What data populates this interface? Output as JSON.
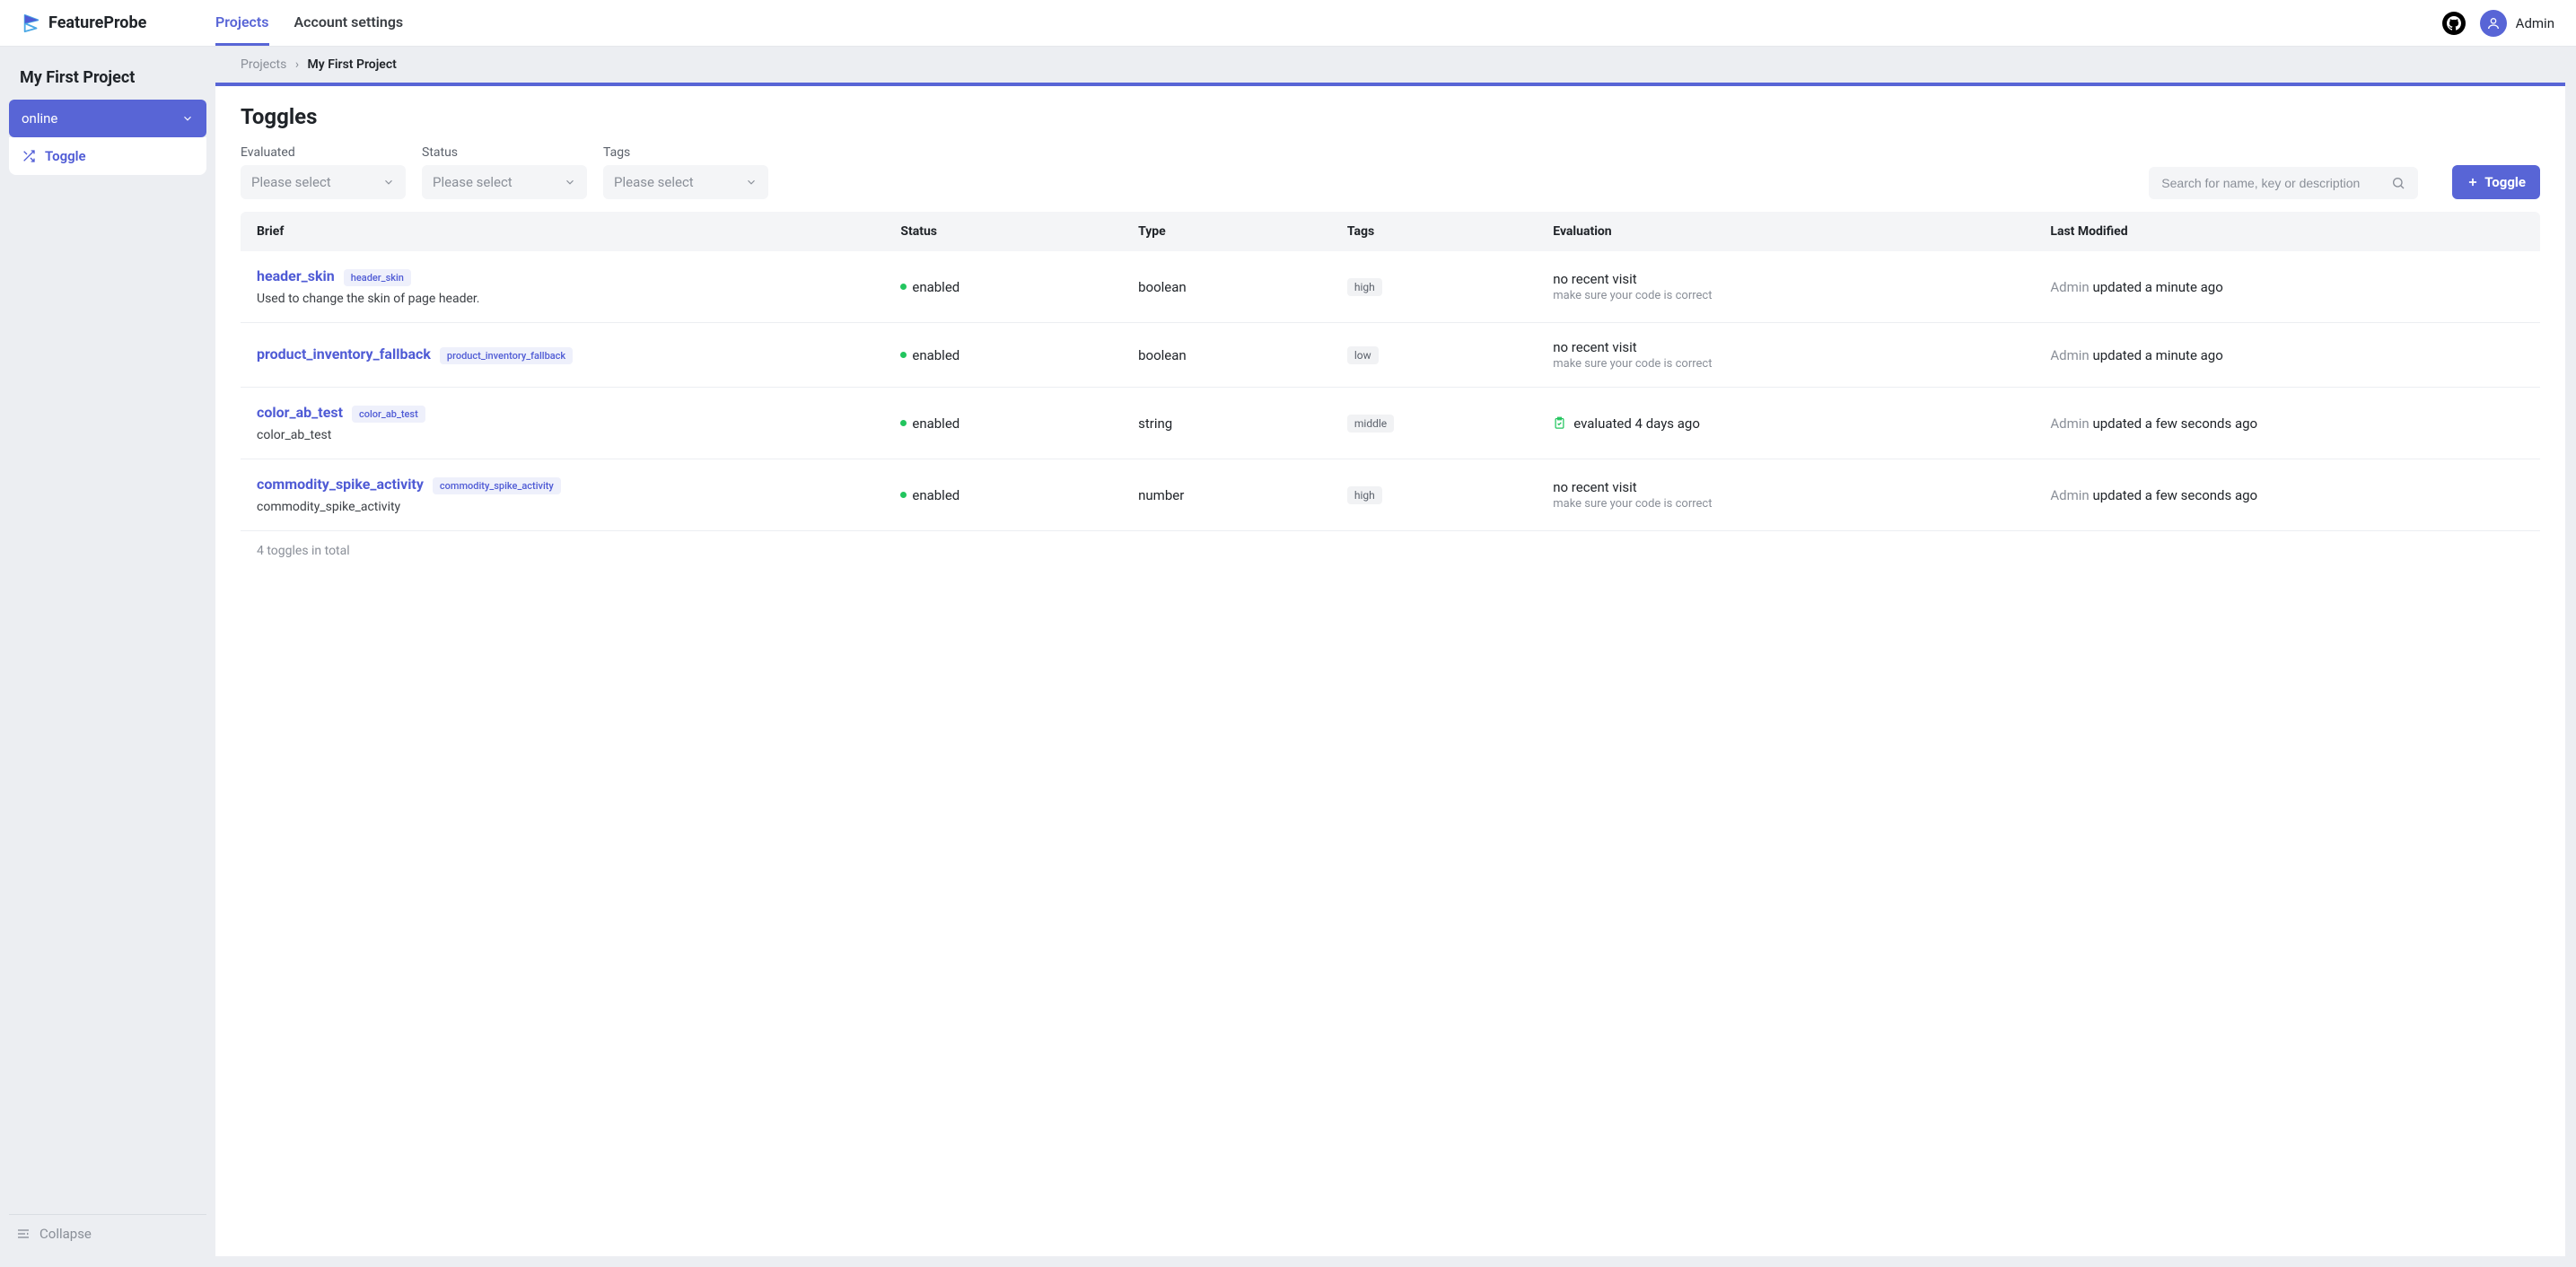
{
  "brand": "FeatureProbe",
  "nav": {
    "projects": "Projects",
    "account": "Account settings"
  },
  "user": {
    "name": "Admin"
  },
  "sidebar": {
    "project": "My First Project",
    "env": "online",
    "link": "Toggle",
    "collapse": "Collapse"
  },
  "breadcrumb": {
    "projects": "Projects",
    "current": "My First Project"
  },
  "page_title": "Toggles",
  "filters": {
    "evaluated_label": "Evaluated",
    "status_label": "Status",
    "tags_label": "Tags",
    "placeholder": "Please select",
    "search_placeholder": "Search for name, key or description",
    "add_button": "Toggle"
  },
  "columns": {
    "brief": "Brief",
    "status": "Status",
    "type": "Type",
    "tags": "Tags",
    "evaluation": "Evaluation",
    "modified": "Last Modified"
  },
  "rows": [
    {
      "name": "header_skin",
      "key": "header_skin",
      "desc": "Used to change the skin of page header.",
      "status": "enabled",
      "type": "boolean",
      "tag": "high",
      "eval_main": "no recent visit",
      "eval_sub": "make sure your code is correct",
      "eval_icon": false,
      "mod_user": "Admin",
      "mod_text": "updated a minute ago"
    },
    {
      "name": "product_inventory_fallback",
      "key": "product_inventory_fallback",
      "desc": "",
      "status": "enabled",
      "type": "boolean",
      "tag": "low",
      "eval_main": "no recent visit",
      "eval_sub": "make sure your code is correct",
      "eval_icon": false,
      "mod_user": "Admin",
      "mod_text": "updated a minute ago"
    },
    {
      "name": "color_ab_test",
      "key": "color_ab_test",
      "desc": "color_ab_test",
      "status": "enabled",
      "type": "string",
      "tag": "middle",
      "eval_main": "evaluated 4 days ago",
      "eval_sub": "",
      "eval_icon": true,
      "mod_user": "Admin",
      "mod_text": "updated a few seconds ago"
    },
    {
      "name": "commodity_spike_activity",
      "key": "commodity_spike_activity",
      "desc": "commodity_spike_activity",
      "status": "enabled",
      "type": "number",
      "tag": "high",
      "eval_main": "no recent visit",
      "eval_sub": "make sure your code is correct",
      "eval_icon": false,
      "mod_user": "Admin",
      "mod_text": "updated a few seconds ago"
    }
  ],
  "totals": "4 toggles in total"
}
